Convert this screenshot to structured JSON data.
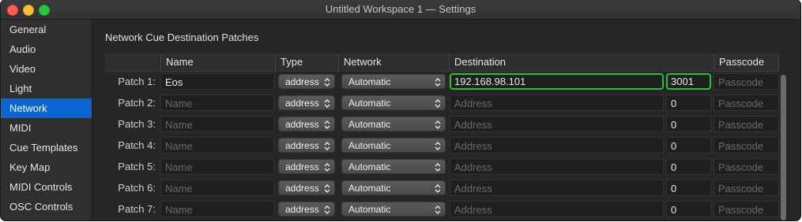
{
  "window": {
    "title": "Untitled Workspace 1 — Settings"
  },
  "sidebar": {
    "items": [
      {
        "label": "General",
        "active": false
      },
      {
        "label": "Audio",
        "active": false
      },
      {
        "label": "Video",
        "active": false
      },
      {
        "label": "Light",
        "active": false
      },
      {
        "label": "Network",
        "active": true
      },
      {
        "label": "MIDI",
        "active": false
      },
      {
        "label": "Cue Templates",
        "active": false
      },
      {
        "label": "Key Map",
        "active": false
      },
      {
        "label": "MIDI Controls",
        "active": false
      },
      {
        "label": "OSC Controls",
        "active": false
      }
    ]
  },
  "main": {
    "heading": "Network Cue Destination Patches",
    "columns": [
      "Name",
      "Type",
      "Network",
      "Destination",
      "Passcode"
    ],
    "placeholders": {
      "name": "Name",
      "address": "Address",
      "passcode": "Passcode"
    },
    "rows": [
      {
        "label": "Patch 1:",
        "name": "Eos",
        "type": "address",
        "network": "Automatic",
        "address": "192.168.98.101",
        "port": "3001",
        "passcode": ""
      },
      {
        "label": "Patch 2:",
        "name": "",
        "type": "address",
        "network": "Automatic",
        "address": "",
        "port": "0",
        "passcode": ""
      },
      {
        "label": "Patch 3:",
        "name": "",
        "type": "address",
        "network": "Automatic",
        "address": "",
        "port": "0",
        "passcode": ""
      },
      {
        "label": "Patch 4:",
        "name": "",
        "type": "address",
        "network": "Automatic",
        "address": "",
        "port": "0",
        "passcode": ""
      },
      {
        "label": "Patch 5:",
        "name": "",
        "type": "address",
        "network": "Automatic",
        "address": "",
        "port": "0",
        "passcode": ""
      },
      {
        "label": "Patch 6:",
        "name": "",
        "type": "address",
        "network": "Automatic",
        "address": "",
        "port": "0",
        "passcode": ""
      },
      {
        "label": "Patch 7:",
        "name": "",
        "type": "address",
        "network": "Automatic",
        "address": "",
        "port": "0",
        "passcode": ""
      }
    ]
  },
  "colors": {
    "accent": "#0a64d2",
    "focus_ring": "#2fbd3a"
  }
}
